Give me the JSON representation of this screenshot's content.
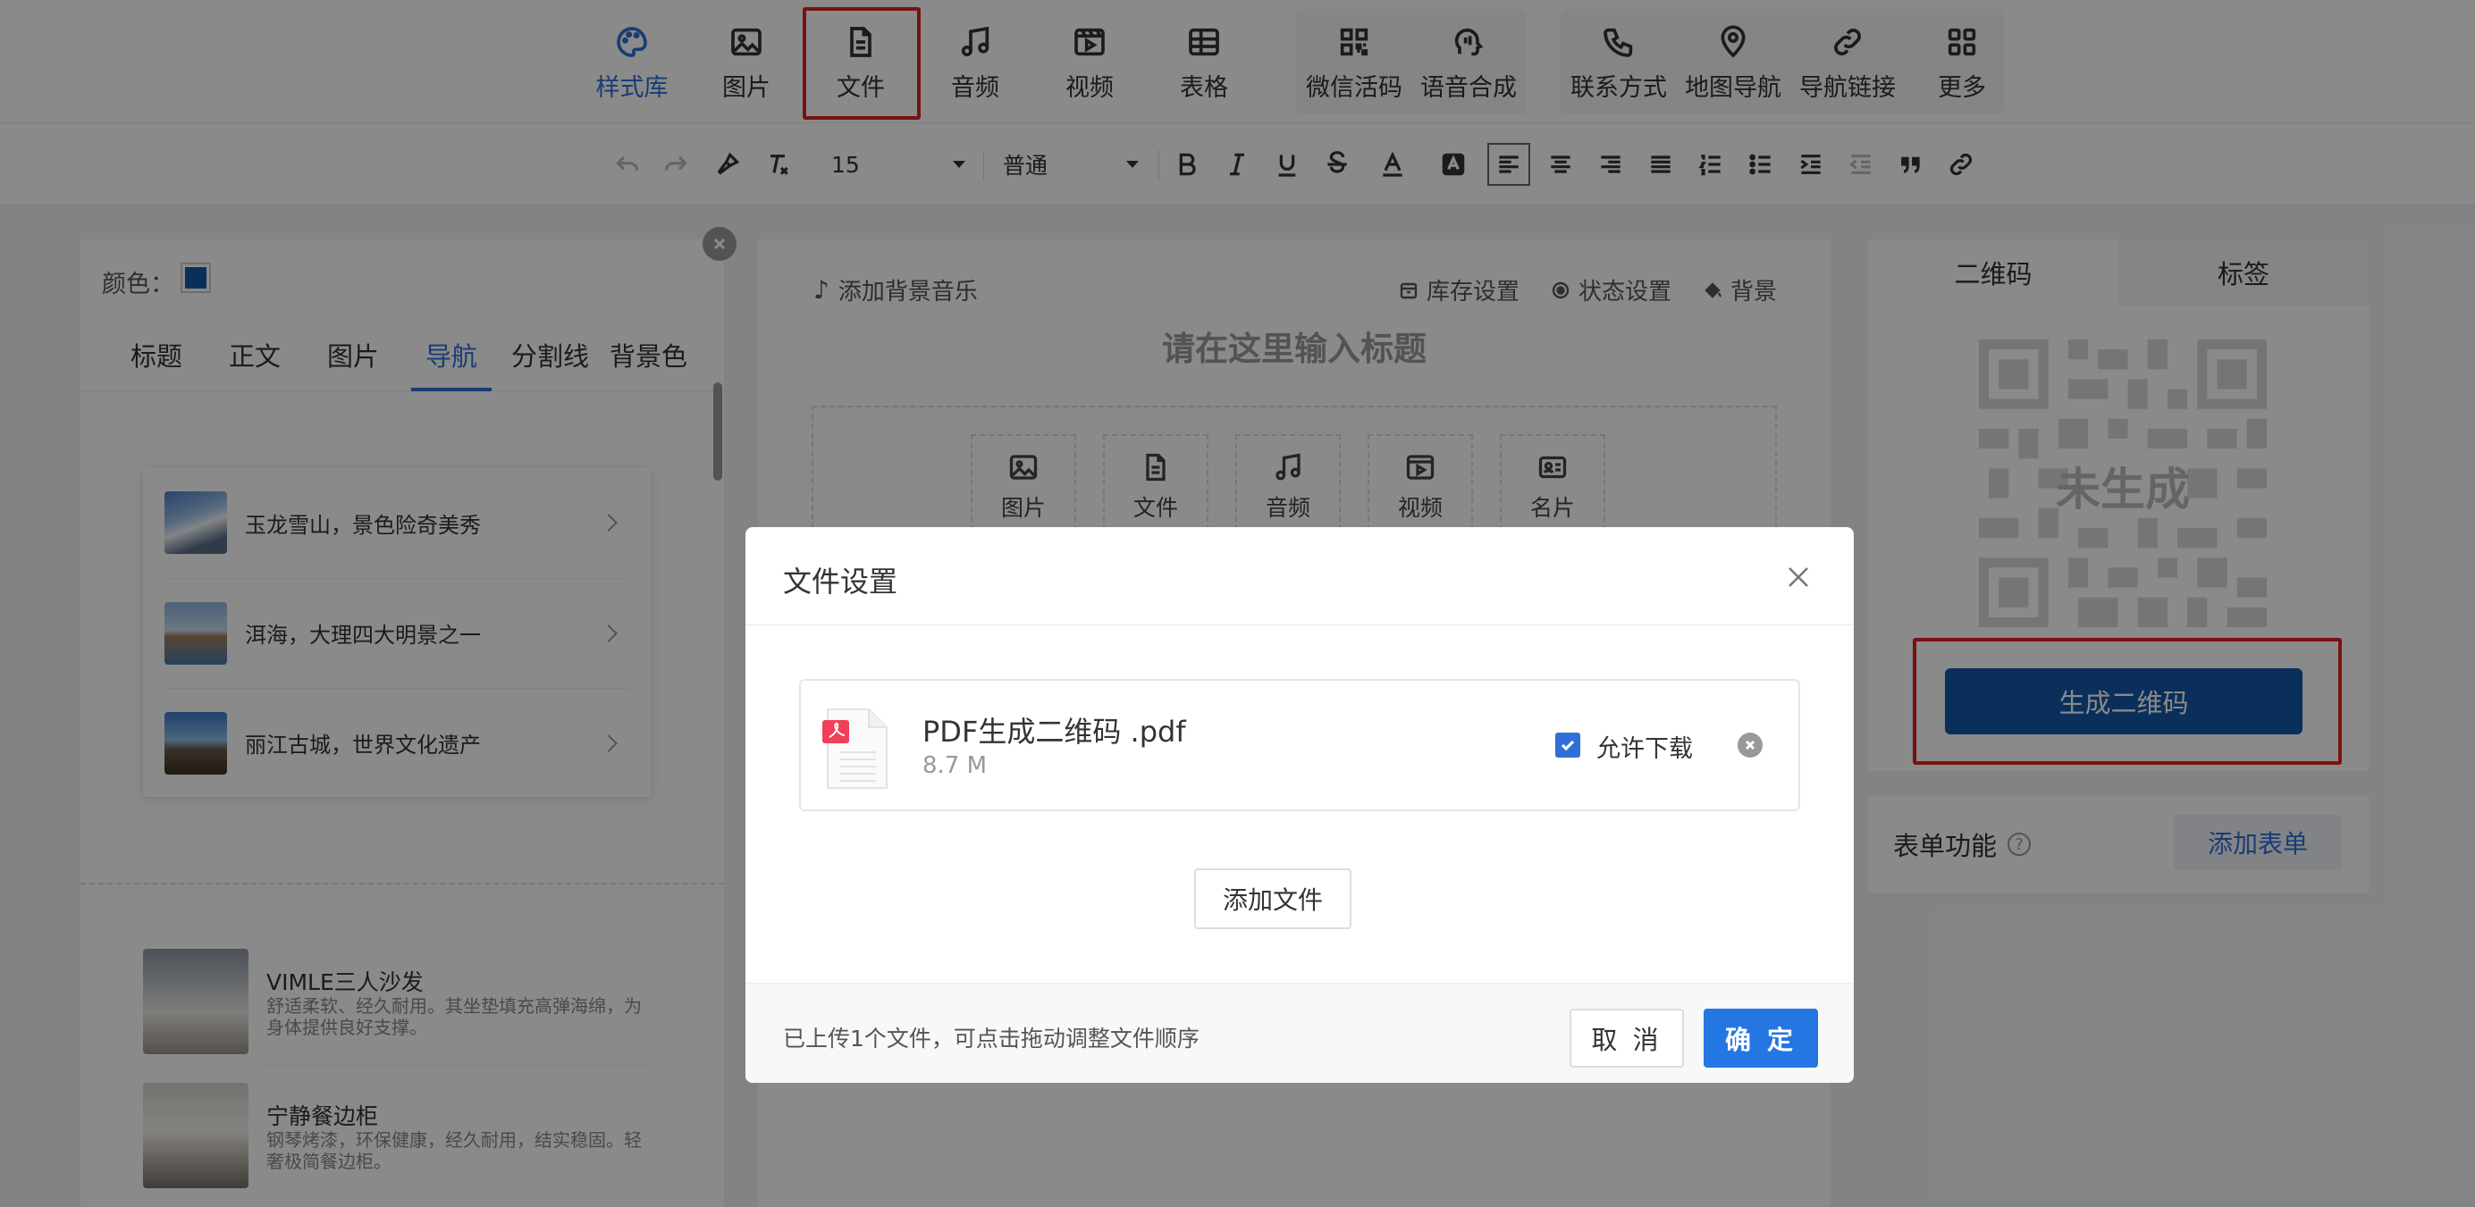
{
  "toolbar": {
    "items": [
      {
        "label": "样式库",
        "icon": "palette-icon"
      },
      {
        "label": "图片",
        "icon": "image-icon"
      },
      {
        "label": "文件",
        "icon": "file-icon"
      },
      {
        "label": "音频",
        "icon": "music-note-icon"
      },
      {
        "label": "视频",
        "icon": "video-icon"
      },
      {
        "label": "表格",
        "icon": "table-icon"
      },
      {
        "label": "微信活码",
        "icon": "qr-grid-icon"
      },
      {
        "label": "语音合成",
        "icon": "voice-synthesis-icon"
      },
      {
        "label": "联系方式",
        "icon": "phone-icon"
      },
      {
        "label": "地图导航",
        "icon": "map-pin-icon"
      },
      {
        "label": "导航链接",
        "icon": "link-icon"
      },
      {
        "label": "更多",
        "icon": "more-grid-icon"
      }
    ],
    "active_color": "#2f6fd6"
  },
  "format_bar": {
    "font_size": "15",
    "paragraph_style": "普通"
  },
  "left_panel": {
    "color_label": "颜色：",
    "color_value": "#1558a8",
    "tabs": [
      "标题",
      "正文",
      "图片",
      "导航",
      "分割线",
      "背景色"
    ],
    "active_tab": "导航",
    "nav_items": [
      {
        "text": "玉龙雪山，景色险奇美秀"
      },
      {
        "text": "洱海，大理四大明景之一"
      },
      {
        "text": "丽江古城，世界文化遗产"
      }
    ],
    "products": [
      {
        "title": "VIMLE三人沙发",
        "desc": "舒适柔软、经久耐用。其坐垫填充高弹海绵，为身体提供良好支撑。"
      },
      {
        "title": "宁静餐边柜",
        "desc": "钢琴烤漆，环保健康，经久耐用，结实稳固。轻奢极简餐边柜。"
      }
    ]
  },
  "editor": {
    "add_music": "添加背景音乐",
    "actions": [
      "库存设置",
      "状态设置",
      "背景"
    ],
    "title_placeholder": "请在这里输入标题",
    "media_buttons": [
      "图片",
      "文件",
      "音频",
      "视频",
      "名片"
    ]
  },
  "right_panel": {
    "tabs": [
      "二维码",
      "标签"
    ],
    "qr_status": "未生成",
    "generate_button": "生成二维码",
    "form_label": "表单功能",
    "help_glyph": "?",
    "add_form_button": "添加表单"
  },
  "modal": {
    "title": "文件设置",
    "file": {
      "name": "PDF生成二维码 .pdf",
      "size": "8.7 M",
      "allow_download_label": "允许下载",
      "allow_download": true
    },
    "add_file_button": "添加文件",
    "hint": "已上传1个文件，可点击拖动调整文件顺序",
    "cancel_button": "取 消",
    "ok_button": "确 定"
  }
}
